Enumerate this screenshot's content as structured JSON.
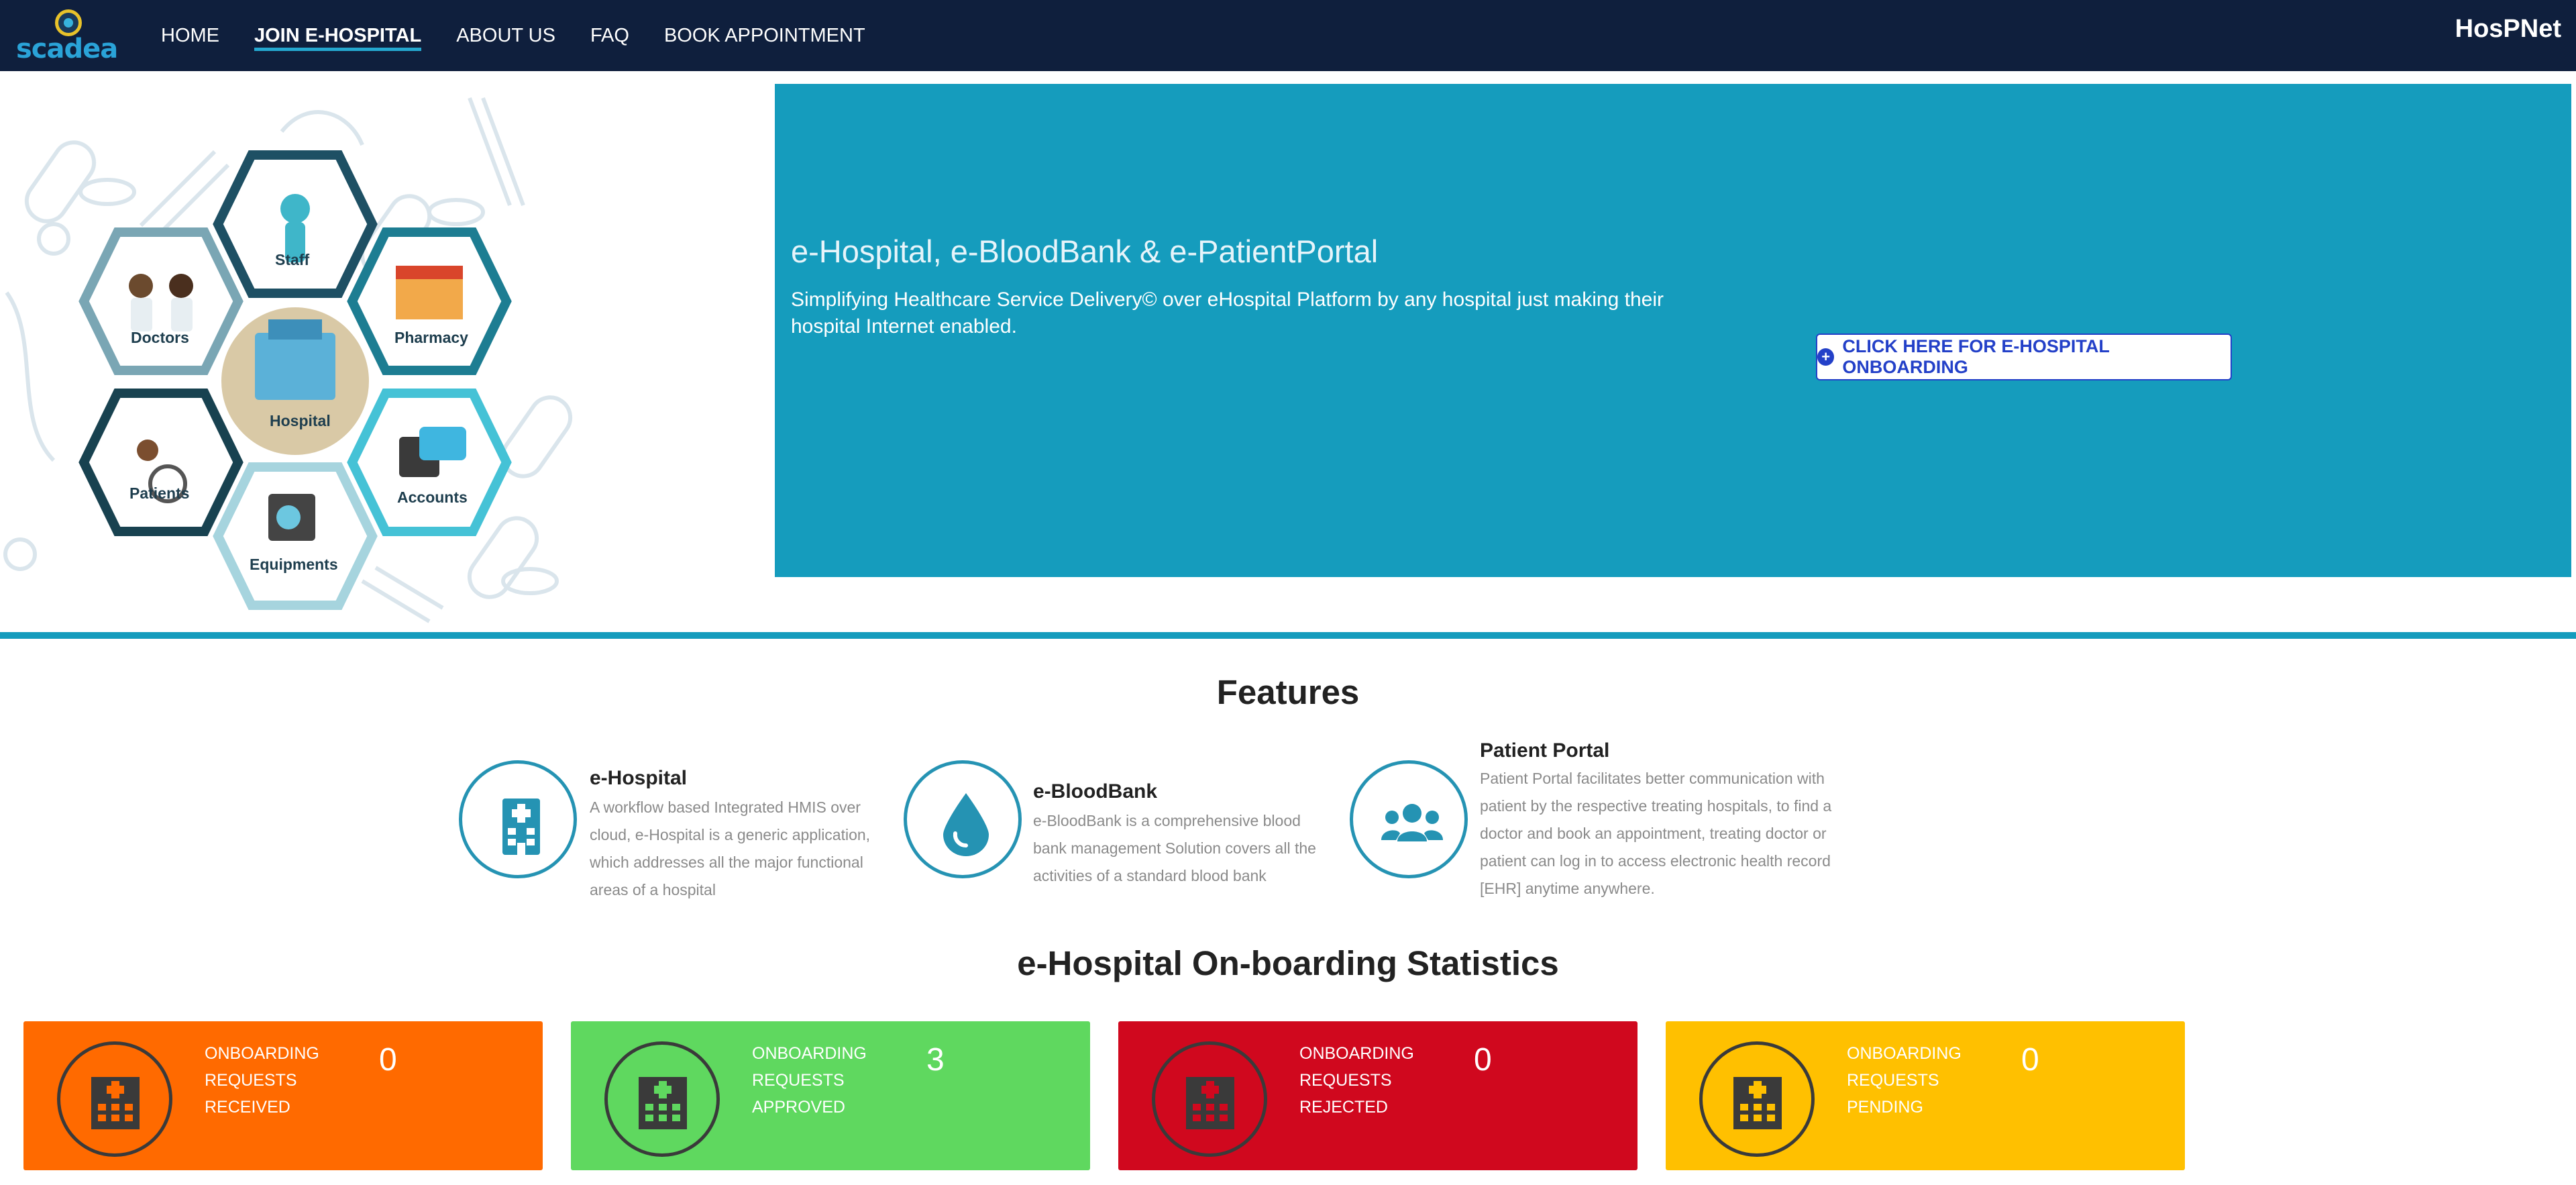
{
  "nav": {
    "logo_text": "scadea",
    "items": [
      {
        "label": "HOME",
        "active": false
      },
      {
        "label": "JOIN E-HOSPITAL",
        "active": true
      },
      {
        "label": "ABOUT US",
        "active": false
      },
      {
        "label": "FAQ",
        "active": false
      },
      {
        "label": "BOOK APPOINTMENT",
        "active": false
      }
    ],
    "brand": "HosPNet"
  },
  "hero": {
    "hex_labels": {
      "staff": "Staff",
      "doctors": "Doctors",
      "pharmacy": "Pharmacy",
      "hospital": "Hospital",
      "patients": "Patients",
      "accounts": "Accounts",
      "equipments": "Equipments"
    },
    "title": "e-Hospital, e-BloodBank & e-PatientPortal",
    "description": "Simplifying Healthcare Service Delivery© over eHospital Platform by any hospital just making their hospital Internet enabled.",
    "button_label": "CLICK HERE FOR E-HOSPITAL ONBOARDING"
  },
  "features": {
    "title": "Features",
    "items": [
      {
        "title": "e-Hospital",
        "icon": "hospital-building-icon",
        "description": "A  workflow based Integrated HMIS over cloud, e-Hospital is a generic application, which addresses all the major functional areas of a hospital"
      },
      {
        "title": "e-BloodBank",
        "icon": "blood-drop-icon",
        "description": "e-BloodBank is a comprehensive blood bank management Solution covers all the activities of a standard blood bank"
      },
      {
        "title": "Patient Portal",
        "icon": "users-group-icon",
        "description": "Patient Portal facilitates better communication with patient by the respective treating hospitals, to find a doctor and book an appointment, treating doctor or patient can log in to access electronic health record [EHR] anytime anywhere."
      }
    ]
  },
  "stats": {
    "title": "e-Hospital On-boarding Statistics",
    "cards": [
      {
        "line1": "ONBOARDING",
        "line2": "REQUESTS",
        "line3": "RECEIVED",
        "count": "0",
        "color": "#ff6a00"
      },
      {
        "line1": "ONBOARDING",
        "line2": "REQUESTS",
        "line3": "APPROVED",
        "count": "3",
        "color": "#5fd85f"
      },
      {
        "line1": "ONBOARDING",
        "line2": "REQUESTS",
        "line3": "REJECTED",
        "count": "0",
        "color": "#d0081e"
      },
      {
        "line1": "ONBOARDING",
        "line2": "REQUESTS",
        "line3": "PENDING",
        "count": "0",
        "color": "#ffc000"
      }
    ]
  }
}
